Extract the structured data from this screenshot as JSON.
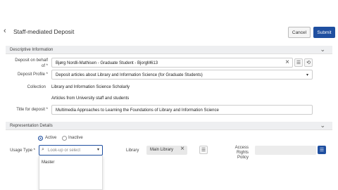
{
  "header": {
    "title": "Staff-mediated Deposit",
    "cancel_label": "Cancel",
    "submit_label": "Submit"
  },
  "descriptive": {
    "section_title": "Descriptive Information",
    "deposit_on_behalf_label_1": "Deposit on behalf",
    "deposit_on_behalf_label_2": "of *",
    "deposit_on_behalf_value": "Bjørg Nordli-Mathisen  - Graduate Student  - BjorgM613",
    "deposit_profile_label": "Deposit Profile *",
    "deposit_profile_value": "Deposit articles about Library and Information Science (for Graduate Students)",
    "collection_label": "Collection",
    "collection_value_1": "Library and Information Science Scholarly",
    "collection_value_2": "Articles from University staff and students",
    "title_label": "Title for deposit *",
    "title_value": "Multimedia Approaches to Learning the Foundations of Library and Information Science"
  },
  "representation": {
    "section_title": "Representation Details",
    "active_label": "Active",
    "inactive_label": "Inactive",
    "usage_type_label": "Usage Type *",
    "usage_type_placeholder": "Look-up or select",
    "usage_type_options": [
      "Master"
    ],
    "library_label": "Library",
    "library_value": "Main Library",
    "access_rights_label_1": "Access",
    "access_rights_label_2": "Rights",
    "access_rights_label_3": "Policy"
  },
  "colors": {
    "accent": "#1f4fa0",
    "section_bg": "#eeeff1"
  }
}
